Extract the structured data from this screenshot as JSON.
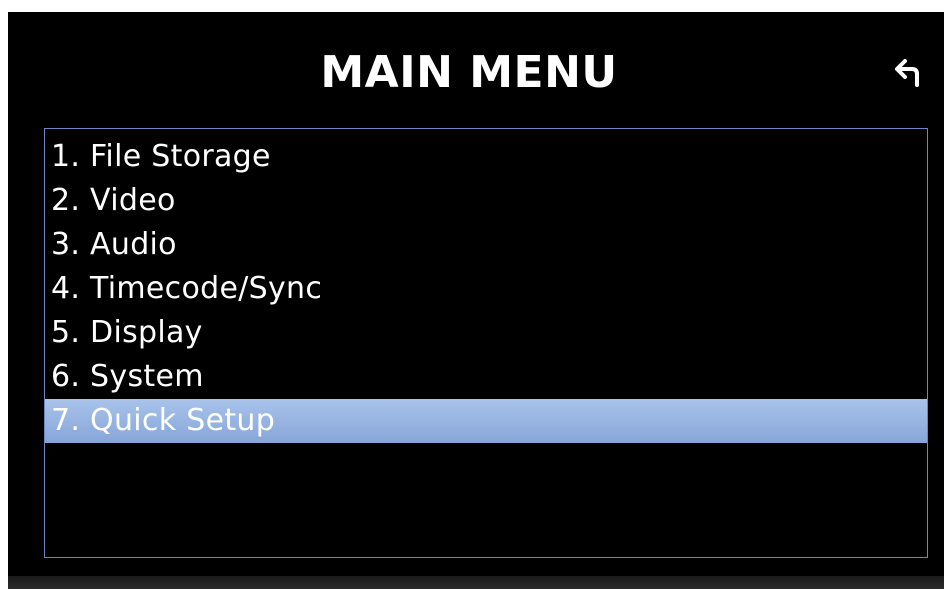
{
  "header": {
    "title": "MAIN MENU",
    "back_icon": "return-arrow-icon"
  },
  "menu": {
    "selected_index": 6,
    "items": [
      {
        "label": "1. File Storage"
      },
      {
        "label": "2. Video"
      },
      {
        "label": "3. Audio"
      },
      {
        "label": "4. Timecode/Sync"
      },
      {
        "label": "5. Display"
      },
      {
        "label": "6. System"
      },
      {
        "label": "7. Quick Setup"
      }
    ]
  },
  "colors": {
    "background": "#000000",
    "text": "#ffffff",
    "menu_border": "#6d86c2",
    "selection": "#97b4e1"
  }
}
